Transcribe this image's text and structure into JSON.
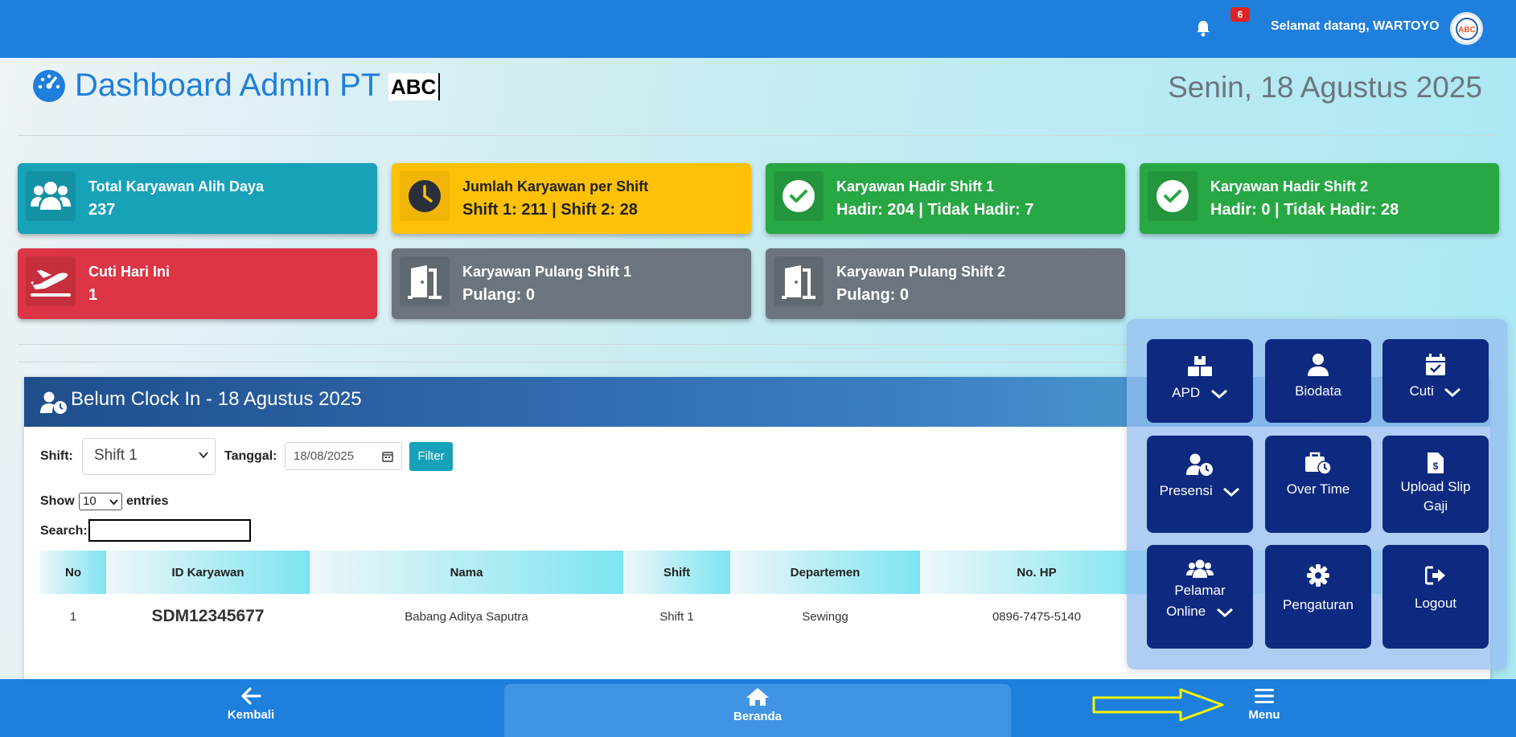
{
  "topbar": {
    "notification_count": "6",
    "welcome_text": "Selamat datang, WARTOYO",
    "avatar_text": "ABC"
  },
  "header": {
    "title": "Dashboard Admin PT",
    "company": "ABC",
    "date": "Senin, 18 Agustus 2025"
  },
  "cards": {
    "total": {
      "label": "Total Karyawan Alih Daya",
      "value": "237"
    },
    "per_shift": {
      "label": "Jumlah Karyawan per Shift",
      "value": "Shift 1: 211 | Shift 2: 28"
    },
    "hadir1": {
      "label": "Karyawan Hadir Shift 1",
      "value": "Hadir: 204 | Tidak Hadir: 7"
    },
    "hadir2": {
      "label": "Karyawan Hadir Shift 2",
      "value": "Hadir: 0 | Tidak Hadir: 28"
    },
    "cuti": {
      "label": "Cuti Hari Ini",
      "value": "1"
    },
    "pulang1": {
      "label": "Karyawan Pulang Shift 1",
      "value": "Pulang: 0"
    },
    "pulang2": {
      "label": "Karyawan Pulang Shift 2",
      "value": "Pulang: 0"
    }
  },
  "panel": {
    "title": "Belum Clock In - 18 Agustus 2025",
    "shift_label": "Shift:",
    "shift_value": "Shift 1",
    "tanggal_label": "Tanggal:",
    "tanggal_value": "18/08/2025",
    "filter_label": "Filter",
    "show_label": "Show",
    "entries_value": "10",
    "entries_label": "entries",
    "search_label": "Search:",
    "columns": [
      "No",
      "ID Karyawan",
      "Nama",
      "Shift",
      "Departemen",
      "No. HP"
    ],
    "rows": [
      {
        "no": "1",
        "id": "SDM12345677",
        "nama": "Babang Aditya Saputra",
        "shift": "Shift 1",
        "dept": "Sewingg",
        "hp": "0896-7475-5140"
      }
    ]
  },
  "menu": {
    "apd": "APD",
    "biodata": "Biodata",
    "cuti": "Cuti",
    "presensi": "Presensi",
    "overtime": "Over Time",
    "slip_line1": "Upload Slip",
    "slip_line2": "Gaji",
    "pelamar_line1": "Pelamar",
    "pelamar_line2": "Online",
    "pengaturan": "Pengaturan",
    "logout": "Logout"
  },
  "bottomnav": {
    "back": "Kembali",
    "home": "Beranda",
    "menu": "Menu"
  },
  "colors": {
    "primary": "#1e7fdc",
    "teal": "#17a2b8",
    "yellow": "#ffc107",
    "green": "#28a745",
    "red": "#dc3545",
    "gray": "#6c757d",
    "menu_tile": "#0d2a80",
    "annotation_arrow": "#f5f500"
  }
}
